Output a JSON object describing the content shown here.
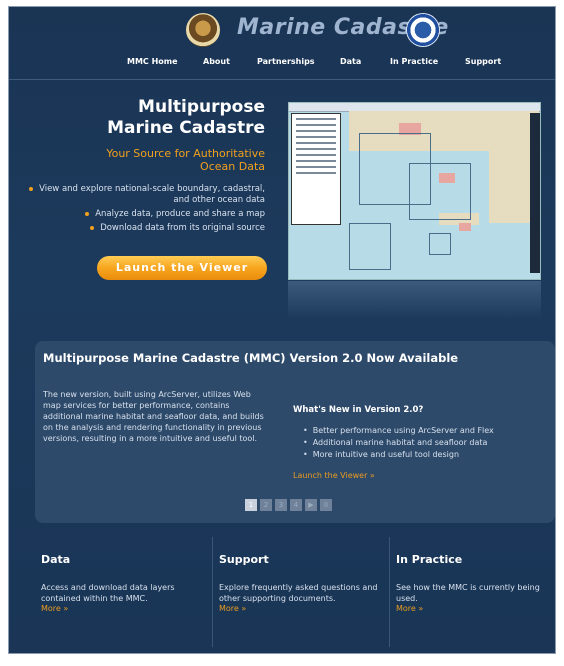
{
  "header": {
    "title": "Marine Cadastre",
    "nav": [
      "MMC Home",
      "About",
      "Partnerships",
      "Data",
      "In Practice",
      "Support"
    ]
  },
  "hero": {
    "title_line1": "Multipurpose",
    "title_line2": "Marine Cadastre",
    "subtitle": "Your Source for Authoritative Ocean Data",
    "bullets": [
      "View and explore national-scale boundary, cadastral, and other ocean data",
      "Analyze data, produce and share a map",
      "Download data from its original source"
    ],
    "launch_label": "Launch the Viewer"
  },
  "news": {
    "title": "Multipurpose Marine Cadastre (MMC) Version 2.0 Now Available",
    "body": "The new version, built using ArcServer, utilizes Web map services for better performance, contains additional marine habitat and seafloor data, and builds on the analysis and rendering functionality in previous versions, resulting in a more intuitive and useful tool.",
    "whats_new_title": "What's New in Version 2.0?",
    "whats_new": [
      "Better performance using ArcServer and Flex",
      "Additional marine habitat and seafloor data",
      "More intuitive and useful tool design"
    ],
    "launch_link": "Launch the Viewer »",
    "pager": {
      "pages": [
        "1",
        "2",
        "3",
        "4"
      ],
      "active": 1,
      "next_glyph": "▶",
      "pause_glyph": "II"
    }
  },
  "columns": [
    {
      "title": "Data",
      "body": "Access and download data layers contained within the MMC.",
      "more": "More »"
    },
    {
      "title": "Support",
      "body": "Explore frequently asked questions and other supporting documents.",
      "more": "More »"
    },
    {
      "title": "In Practice",
      "body": "See how the MMC is currently being used.",
      "more": "More »"
    }
  ],
  "colors": {
    "accent": "#f0a01c",
    "background": "#1c3a5c",
    "panel": "#2e4a6b"
  }
}
